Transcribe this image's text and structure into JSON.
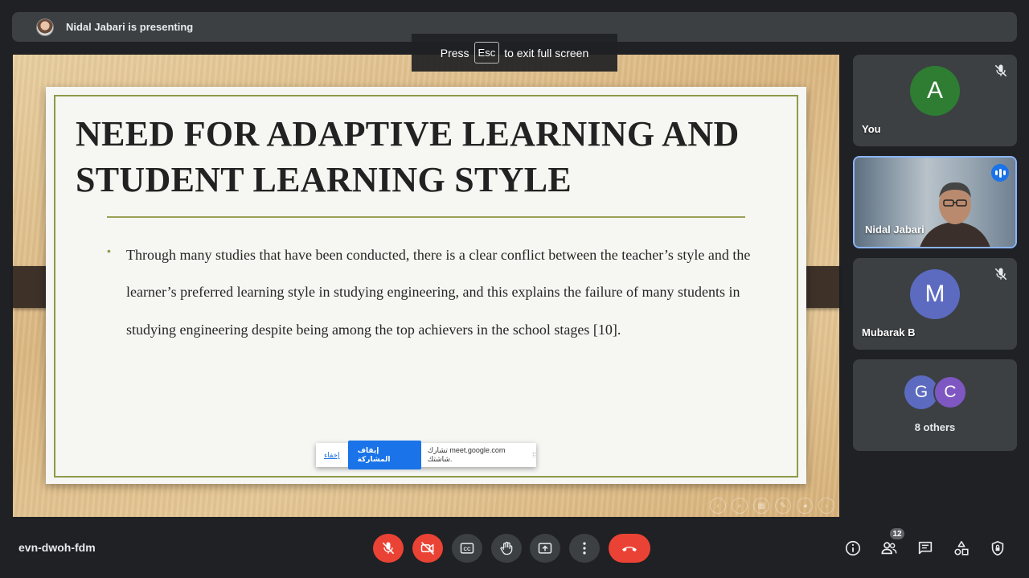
{
  "presenter": {
    "text": "Nidal Jabari is presenting"
  },
  "fullscreen_toast": {
    "press": "Press",
    "key": "Esc",
    "suffix": "to exit full screen"
  },
  "slide": {
    "title": "NEED FOR ADAPTIVE LEARNING AND STUDENT LEARNING STYLE",
    "bullet": "•",
    "body": "Through many studies that have been conducted, there is a clear conflict between the teacher’s style and the learner’s preferred learning style in studying engineering, and this explains the failure of many students in studying engineering despite being among the top achievers in the school stages [10]."
  },
  "share_bar": {
    "hide_label": "إخفاء",
    "stop_label": "إيقاف المشاركة",
    "message": "تشارك meet.google.com شاشتك.",
    "grip": "⁞⁞"
  },
  "participants": [
    {
      "name": "You",
      "initial": "A",
      "color": "#2e7d32",
      "muted": true
    },
    {
      "name": "Nidal Jabari",
      "speaking": true,
      "video": true
    },
    {
      "name": "Mubarak B",
      "initial": "M",
      "color": "#5c6bc0",
      "muted": true
    }
  ],
  "others": {
    "initials": [
      "G",
      "C"
    ],
    "colors": [
      "#5c6bc0",
      "#7e57c2"
    ],
    "label": "8 others"
  },
  "meeting": {
    "code": "evn-dwoh-fdm",
    "participant_count": "12"
  },
  "controls": [
    "mic-off-icon",
    "camera-off-icon",
    "captions-icon",
    "raise-hand-icon",
    "present-icon",
    "more-options-icon",
    "end-call-icon"
  ],
  "right_controls": [
    "info-icon",
    "people-icon",
    "chat-icon",
    "activities-icon",
    "host-controls-icon"
  ]
}
